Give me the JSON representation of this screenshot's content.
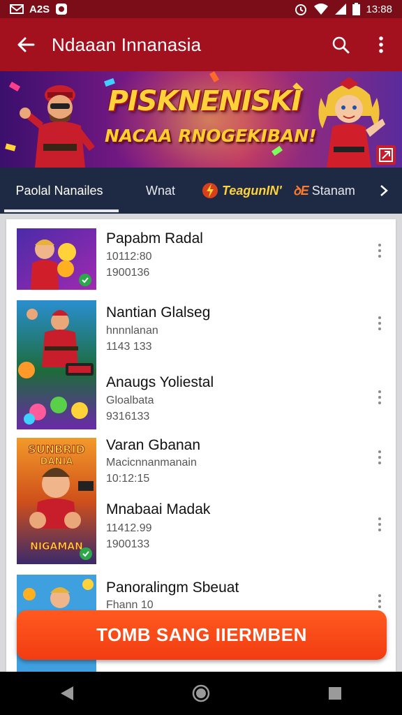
{
  "status_bar": {
    "left_text": "A2S",
    "time": "13:88",
    "icons": [
      "mail-icon",
      "shield-app-icon",
      "alarm-icon",
      "wifi-icon",
      "signal-icon",
      "battery-icon"
    ]
  },
  "app_bar": {
    "title": "Ndaaan Innanasia",
    "icons": [
      "back-arrow-icon",
      "search-icon",
      "more-vert-icon"
    ]
  },
  "banner": {
    "title": "PISKNENISKI",
    "subtitle": "NACAA RNOGEKIBAN!",
    "colors": {
      "title": "#ffd23a",
      "outline": "#a3111e"
    }
  },
  "tabs": {
    "items": [
      {
        "label": "Paolal Nanailes",
        "selected": true
      },
      {
        "label": "Wnat",
        "selected": false
      },
      {
        "label": "TeagunIN'",
        "icon": "lightning-icon",
        "selected": false
      },
      {
        "label": "Stanam",
        "prefix": "ꝺE",
        "selected": false
      }
    ],
    "next_icon": "chevron-right-icon"
  },
  "list": {
    "items": [
      {
        "title": "Papabm Radal",
        "line2": "10112:80",
        "line3": "1900136"
      },
      {
        "title": "Nantian Glalseg",
        "line2": "hnnnlanan",
        "line3": "1143 133"
      },
      {
        "title": "Anaugs Yoliestal",
        "line2": "Gloalbata",
        "line3": "9316133"
      },
      {
        "title": "Varan Gbanan",
        "line2": "Macicnnanmanain",
        "line3": "10:12:15"
      },
      {
        "title": "Mnabaai Madak",
        "line2": "11412.99",
        "line3": "1900133"
      },
      {
        "title": "Panoralingm Sbeuat",
        "line2": "Fhann 10",
        "line3": ""
      }
    ]
  },
  "cta": {
    "label": "TOMB SANG IIERMBEN",
    "color": "#f23c12"
  },
  "nav_bar": {
    "icons": [
      "nav-back-icon",
      "nav-home-icon",
      "nav-recents-icon"
    ]
  }
}
